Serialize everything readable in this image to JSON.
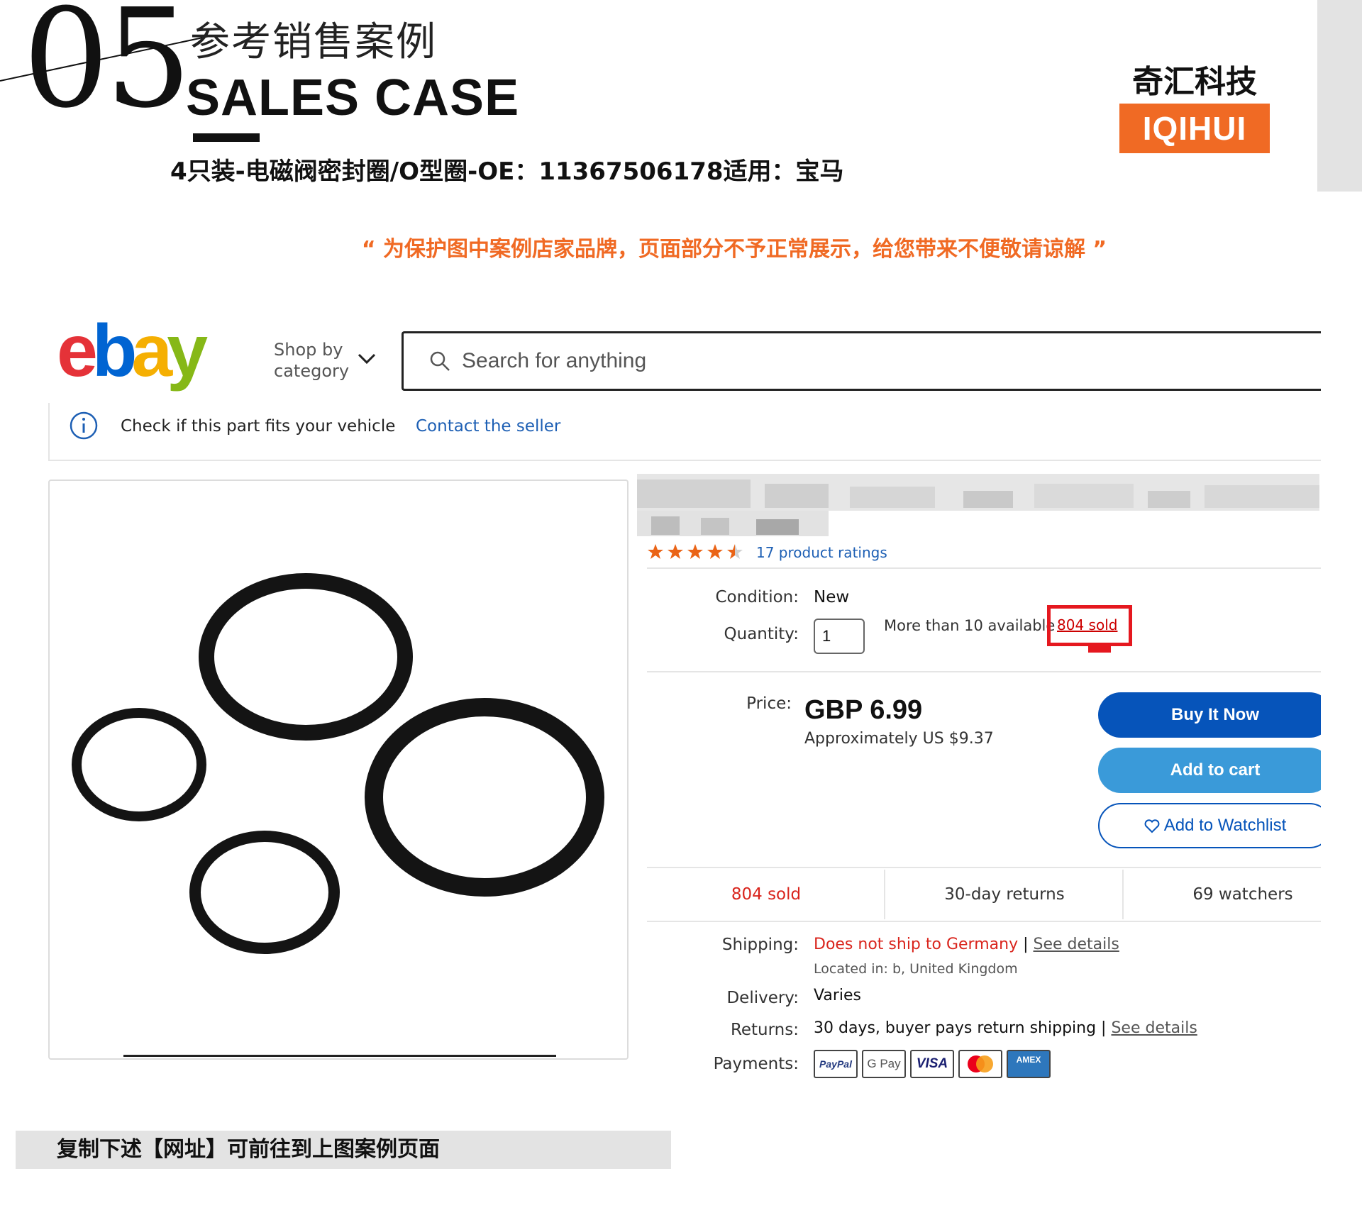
{
  "header": {
    "number": "05",
    "title_cn": "参考销售案例",
    "title_en": "SALES CASE",
    "product_title": "4只装-电磁阀密封圈/O型圈-OE：11367506178适用：宝马",
    "brand_cn": "奇汇科技",
    "brand_en": "IQIHUI",
    "notice": "“ 为保护图中案例店家品牌，页面部分不予正常展示，给您带来不便敬请谅解 ”"
  },
  "ebay": {
    "shop_by_line1": "Shop by",
    "shop_by_line2": "category",
    "search_placeholder": "Search for anything",
    "fit_text": "Check if this part fits your vehicle",
    "contact_seller": "Contact the seller",
    "rating": 4.5,
    "ratings_link": "17 product ratings",
    "condition_label": "Condition:",
    "condition_value": "New",
    "quantity_label": "Quantity:",
    "quantity_value": "1",
    "availability": "More than 10 available",
    "sold_link": "804 sold",
    "price_label": "Price:",
    "price": "GBP 6.99",
    "approx_price": "Approximately US $9.37",
    "buy_now": "Buy It Now",
    "add_to_cart": "Add to cart",
    "add_to_watchlist": "Add to Watchlist",
    "stats": [
      "804 sold",
      "30-day returns",
      "69 watchers"
    ],
    "shipping_label": "Shipping:",
    "shipping_value": "Does not ship to Germany",
    "shipping_sep": " | ",
    "see_details": "See details",
    "located_label": "Located in:",
    "located_value": "b, United Kingdom",
    "delivery_label": "Delivery:",
    "delivery_value": "Varies",
    "returns_label": "Returns:",
    "returns_value": "30 days, buyer pays return shipping",
    "returns_sep": " | ",
    "payments_label": "Payments:",
    "payment_methods": [
      "PayPal",
      "G Pay",
      "VISA",
      "mastercard",
      "AMEX"
    ],
    "colors": {
      "ebay_red": "#e53238",
      "ebay_blue": "#0064d2",
      "ebay_yellow": "#f5af02",
      "ebay_green": "#86b817",
      "buy_button": "#0654ba",
      "cart_button": "#3a9ad9",
      "highlight": "#e5181f"
    }
  },
  "footer": {
    "text": "复制下述【网址】可前往到上图案例页面"
  }
}
